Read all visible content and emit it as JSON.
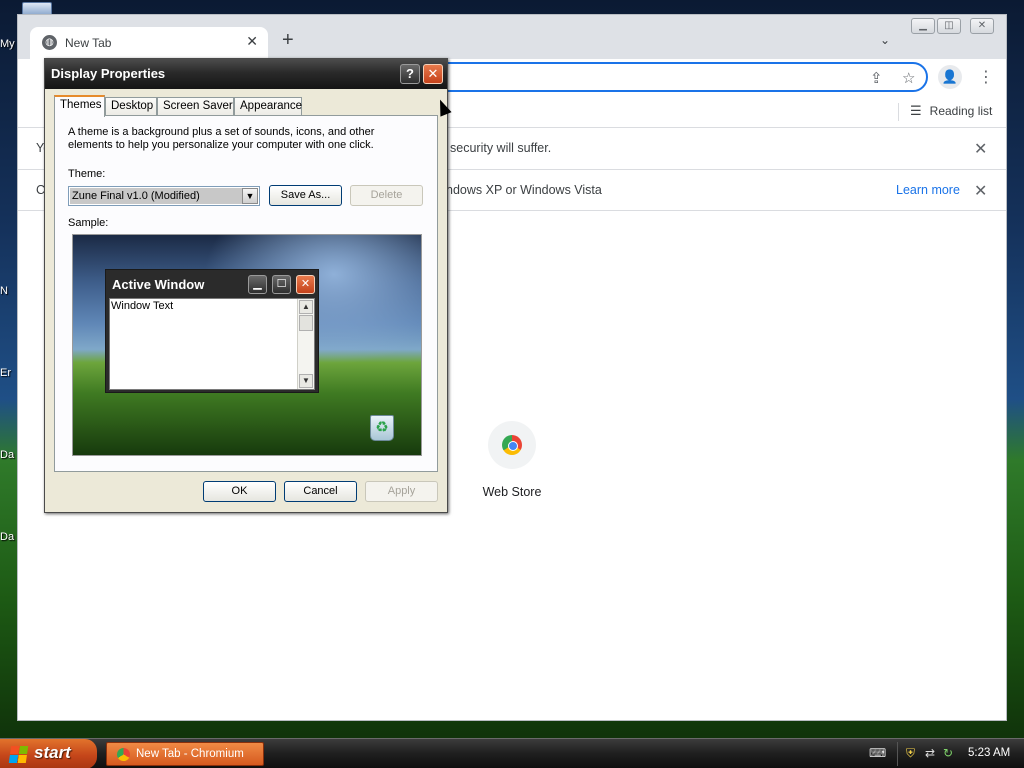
{
  "desktop": {
    "icon_labels": [
      "My",
      "N",
      "Er",
      "Da",
      "Da"
    ]
  },
  "browser": {
    "tab": {
      "title": "New Tab",
      "close": "✕"
    },
    "new_tab": "+",
    "tab_search": "⌄",
    "window_controls": {
      "minimize": "▁",
      "restore": "◫",
      "close": "✕"
    },
    "toolbar": {
      "share": "⇪",
      "star": "☆",
      "profile": "👤",
      "menu": "⋮"
    },
    "reading_list": {
      "icon": "☰",
      "label": "Reading list"
    },
    "infobar_1": {
      "prefix": "Yo",
      "text": "security will suffer.",
      "close": "✕"
    },
    "infobar_2": {
      "prefix": "C",
      "text": "ndows XP or Windows Vista",
      "link": "Learn more",
      "close": "✕"
    },
    "shortcut": {
      "label": "Web Store"
    }
  },
  "dialog": {
    "title": "Display Properties",
    "help": "?",
    "close": "✕",
    "tabs": [
      "Themes",
      "Desktop",
      "Screen Saver",
      "Appearance"
    ],
    "description": "A theme is a background plus a set of sounds, icons, and other elements to help you personalize your computer with one click.",
    "theme_label": "Theme:",
    "theme_value": "Zune Final v1.0 (Modified)",
    "save_as": "Save As...",
    "delete": "Delete",
    "sample_label": "Sample:",
    "sample_window": {
      "title": "Active Window",
      "minimize": "▁",
      "maximize": "☐",
      "close": "✕",
      "text": "Window Text"
    },
    "ok": "OK",
    "cancel": "Cancel",
    "apply": "Apply"
  },
  "taskbar": {
    "start": "start",
    "task_item": "New Tab - Chromium",
    "clock": "5:23 AM"
  }
}
